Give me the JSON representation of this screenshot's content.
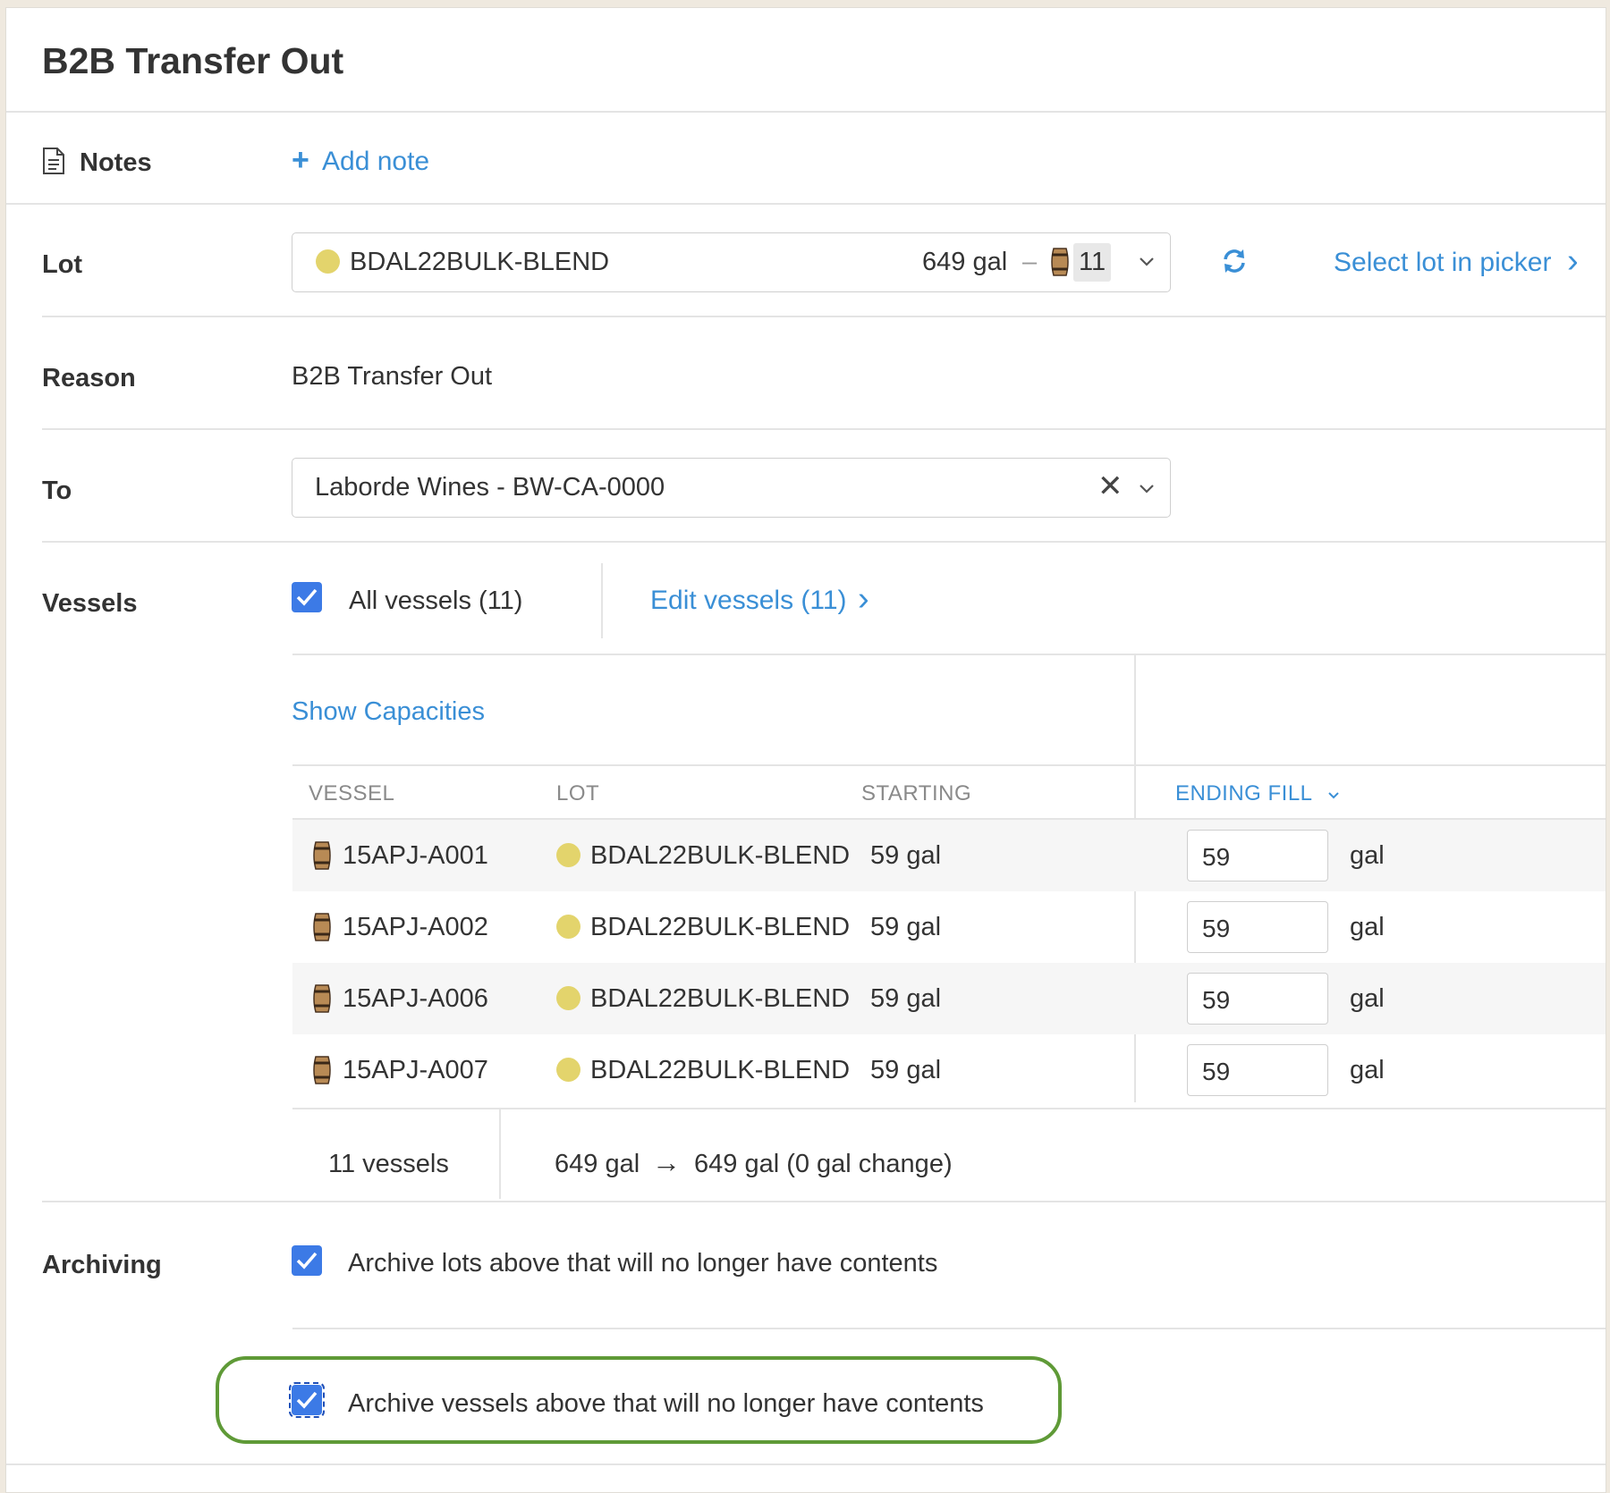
{
  "header": {
    "title": "B2B Transfer Out"
  },
  "notes": {
    "label": "Notes",
    "add_label": "Add note",
    "add_plus": "+"
  },
  "lot": {
    "label": "Lot",
    "value": "BDAL22BULK-BLEND",
    "volume": "649 gal",
    "separator": "–",
    "vessel_count": "11",
    "refresh_link": "Select lot in picker",
    "chevron": "›"
  },
  "reason": {
    "label": "Reason",
    "value": "B2B Transfer Out"
  },
  "to": {
    "label": "To",
    "value": "Laborde Wines - BW-CA-0000",
    "clear": "✕"
  },
  "vessels": {
    "label": "Vessels",
    "all_label": "All vessels (11)",
    "edit_link": "Edit vessels (11)",
    "chevron": "›",
    "show_capacities": "Show Capacities",
    "columns": {
      "vessel": "VESSEL",
      "lot": "LOT",
      "starting": "STARTING",
      "ending": "ENDING FILL"
    },
    "rows": [
      {
        "vessel": "15APJ-A001",
        "lot": "BDAL22BULK-BLEND",
        "starting": "59 gal",
        "ending": "59",
        "unit": "gal"
      },
      {
        "vessel": "15APJ-A002",
        "lot": "BDAL22BULK-BLEND",
        "starting": "59 gal",
        "ending": "59",
        "unit": "gal"
      },
      {
        "vessel": "15APJ-A006",
        "lot": "BDAL22BULK-BLEND",
        "starting": "59 gal",
        "ending": "59",
        "unit": "gal"
      },
      {
        "vessel": "15APJ-A007",
        "lot": "BDAL22BULK-BLEND",
        "starting": "59 gal",
        "ending": "59",
        "unit": "gal"
      }
    ],
    "summary_count": "11 vessels",
    "summary_from": "649 gal",
    "summary_arrow": "→",
    "summary_to": "649 gal (0 gal change)"
  },
  "archiving": {
    "label": "Archiving",
    "lots_label": "Archive lots above that will no longer have contents",
    "vessels_label": "Archive vessels above that will no longer have contents"
  },
  "colors": {
    "accent": "#3a8fd6",
    "checkbox": "#3c7ae6",
    "lot_dot": "#e3d46c",
    "highlight": "#5f9a37"
  },
  "icons": {
    "notes": "document-icon",
    "refresh": "refresh-icon",
    "barrel": "barrel-icon",
    "check": "check-icon"
  }
}
